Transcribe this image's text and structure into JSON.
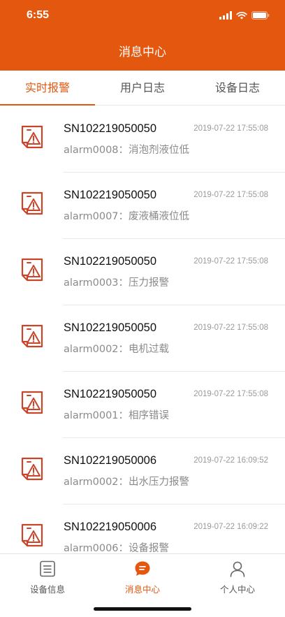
{
  "status": {
    "time": "6:55"
  },
  "header": {
    "title": "消息中心"
  },
  "tabs": [
    {
      "label": "实时报警",
      "active": true
    },
    {
      "label": "用户日志",
      "active": false
    },
    {
      "label": "设备日志",
      "active": false
    }
  ],
  "messages": [
    {
      "serial": "SN102219050050",
      "time": "2019-07-22 17:55:08",
      "desc": "alarm0008：消泡剂液位低",
      "icon": "alarm-warning-icon"
    },
    {
      "serial": "SN102219050050",
      "time": "2019-07-22 17:55:08",
      "desc": "alarm0007：废液桶液位低",
      "icon": "alarm-warning-icon"
    },
    {
      "serial": "SN102219050050",
      "time": "2019-07-22 17:55:08",
      "desc": "alarm0003：压力报警",
      "icon": "alarm-warning-icon"
    },
    {
      "serial": "SN102219050050",
      "time": "2019-07-22 17:55:08",
      "desc": "alarm0002：电机过载",
      "icon": "alarm-warning-icon"
    },
    {
      "serial": "SN102219050050",
      "time": "2019-07-22 17:55:08",
      "desc": "alarm0001：相序错误",
      "icon": "alarm-warning-icon"
    },
    {
      "serial": "SN102219050006",
      "time": "2019-07-22 16:09:52",
      "desc": "alarm0002：出水压力报警",
      "icon": "alarm-warning-icon"
    },
    {
      "serial": "SN102219050006",
      "time": "2019-07-22 16:09:22",
      "desc": "alarm0006：设备报警",
      "icon": "alarm-warning-icon"
    }
  ],
  "tabbar": [
    {
      "label": "设备信息",
      "icon": "device-info-icon",
      "active": false
    },
    {
      "label": "消息中心",
      "icon": "message-center-icon",
      "active": true
    },
    {
      "label": "个人中心",
      "icon": "profile-icon",
      "active": false
    }
  ],
  "colors": {
    "accent": "#E3570E",
    "alarm_icon": "#C9452A"
  }
}
